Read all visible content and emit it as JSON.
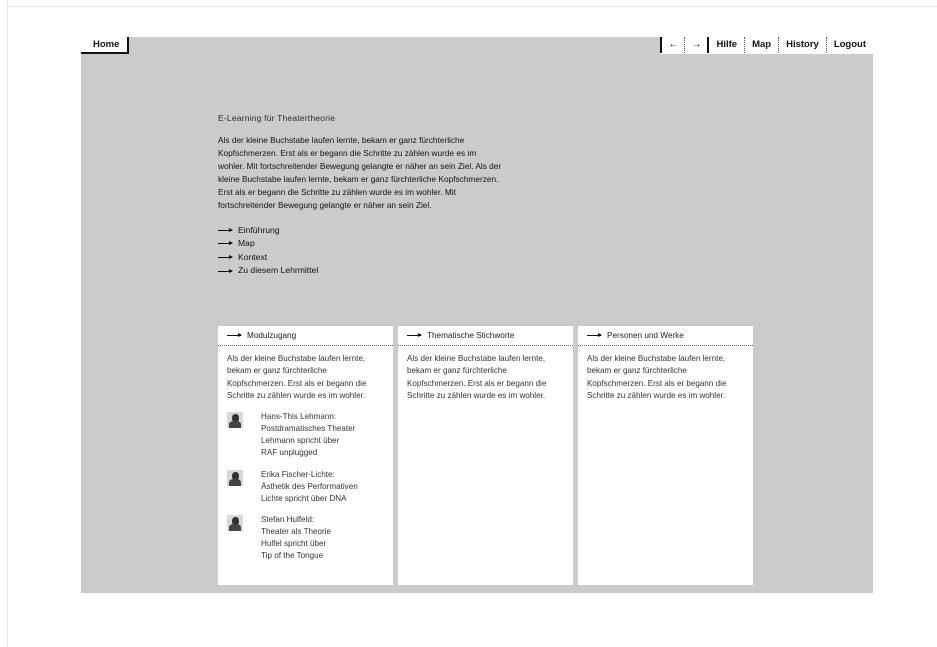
{
  "nav": {
    "home": "Home",
    "back": "←",
    "forward": "→",
    "hilfe": "Hilfe",
    "map": "Map",
    "history": "History",
    "logout": "Logout"
  },
  "main": {
    "site_title": "E-Learning für Theatertheorie",
    "intro": "Als der kleine Buchstabe laufen lernte, bekam er ganz fürchterliche Kopfschmerzen. Erst als er begann die Schritte zu zählen wurde es im wohler. Mit fortschreitender Bewegung gelangte er näher an sein Ziel. Als der kleine Buchstabe laufen lernte, bekam er ganz fürchterliche Kopfschmerzen. Erst als er begann die Schritte zu zählen wurde es im wohler. Mit fortschreitender Bewegung gelangte er näher an sein Ziel.",
    "links": [
      "Einführung",
      "Map",
      "Kontext",
      "Zu diesem Lehrmittel"
    ]
  },
  "panels": [
    {
      "title": "Modulzugang",
      "body": "Als der kleine Buchstabe laufen lernte, bekam er ganz fürchterliche Kopfschmerzen. Erst als er begann die Schritte zu zählen wurde es im wohler.",
      "people": [
        {
          "lines": [
            "Hans-This Lehmann:",
            "Postdramatisches Theater",
            "Lehmann spricht über",
            "RAF unplugged"
          ]
        },
        {
          "lines": [
            "Erika Fischer-Lichte:",
            "Ästhetik des Performativen",
            "Lichte spricht über DNA"
          ]
        },
        {
          "lines": [
            "Stefan Hulfeld:",
            "Theater als Theorie",
            "Hulfel spricht über",
            "Tip of the Tongue"
          ]
        }
      ]
    },
    {
      "title": "Thematische Stichworte",
      "body": "Als der kleine Buchstabe laufen lernte, bekam er ganz fürchterliche Kopfschmerzen. Erst als er begann die Schritte zu zählen wurde es im wohler."
    },
    {
      "title": "Personen und Werke",
      "body": "Als der kleine Buchstabe laufen lernte, bekam er ganz fürchterliche Kopfschmerzen. Erst als er begann die Schritte zu zählen wurde es im wohler."
    }
  ],
  "icons": {
    "link_arrow": "right-arrow-icon",
    "person_thumb": "portrait-thumbnail"
  },
  "colors": {
    "stage": "#cbcbcb",
    "panel": "#ffffff",
    "text": "#111111"
  }
}
